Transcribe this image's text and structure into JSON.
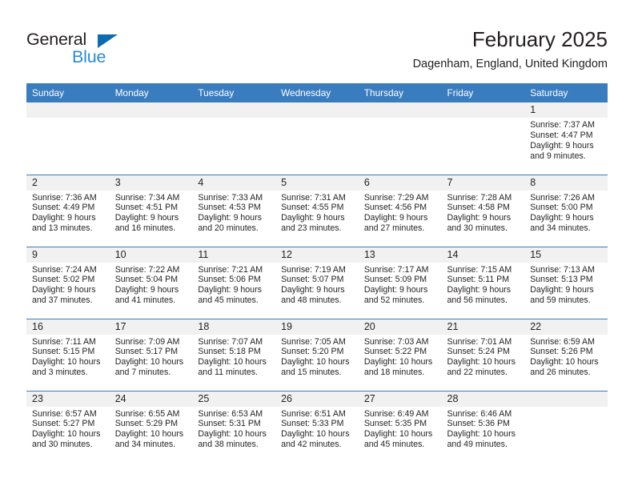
{
  "logo": {
    "word_one": "General",
    "word_two": "Blue",
    "triangle_icon": "blue-triangle-icon",
    "accent_dark": "#0f6ab0",
    "accent_light": "#2b8bd4"
  },
  "header": {
    "title": "February 2025",
    "subtitle": "Dagenham, England, United Kingdom"
  },
  "colors": {
    "header_blue": "#3a7dbf",
    "daynum_background": "#f1f1f1",
    "text": "#231f20"
  },
  "weekday_headers": [
    "Sunday",
    "Monday",
    "Tuesday",
    "Wednesday",
    "Thursday",
    "Friday",
    "Saturday"
  ],
  "labels": {
    "sunrise_prefix": "Sunrise:",
    "sunset_prefix": "Sunset:",
    "daylight_prefix": "Daylight:"
  },
  "weeks": [
    [
      {
        "day": "",
        "empty": true
      },
      {
        "day": "",
        "empty": true
      },
      {
        "day": "",
        "empty": true
      },
      {
        "day": "",
        "empty": true
      },
      {
        "day": "",
        "empty": true
      },
      {
        "day": "",
        "empty": true
      },
      {
        "day": "1",
        "sunrise": "Sunrise: 7:37 AM",
        "sunset": "Sunset: 4:47 PM",
        "daylight1": "Daylight: 9 hours",
        "daylight2": "and 9 minutes."
      }
    ],
    [
      {
        "day": "2",
        "sunrise": "Sunrise: 7:36 AM",
        "sunset": "Sunset: 4:49 PM",
        "daylight1": "Daylight: 9 hours",
        "daylight2": "and 13 minutes."
      },
      {
        "day": "3",
        "sunrise": "Sunrise: 7:34 AM",
        "sunset": "Sunset: 4:51 PM",
        "daylight1": "Daylight: 9 hours",
        "daylight2": "and 16 minutes."
      },
      {
        "day": "4",
        "sunrise": "Sunrise: 7:33 AM",
        "sunset": "Sunset: 4:53 PM",
        "daylight1": "Daylight: 9 hours",
        "daylight2": "and 20 minutes."
      },
      {
        "day": "5",
        "sunrise": "Sunrise: 7:31 AM",
        "sunset": "Sunset: 4:55 PM",
        "daylight1": "Daylight: 9 hours",
        "daylight2": "and 23 minutes."
      },
      {
        "day": "6",
        "sunrise": "Sunrise: 7:29 AM",
        "sunset": "Sunset: 4:56 PM",
        "daylight1": "Daylight: 9 hours",
        "daylight2": "and 27 minutes."
      },
      {
        "day": "7",
        "sunrise": "Sunrise: 7:28 AM",
        "sunset": "Sunset: 4:58 PM",
        "daylight1": "Daylight: 9 hours",
        "daylight2": "and 30 minutes."
      },
      {
        "day": "8",
        "sunrise": "Sunrise: 7:26 AM",
        "sunset": "Sunset: 5:00 PM",
        "daylight1": "Daylight: 9 hours",
        "daylight2": "and 34 minutes."
      }
    ],
    [
      {
        "day": "9",
        "sunrise": "Sunrise: 7:24 AM",
        "sunset": "Sunset: 5:02 PM",
        "daylight1": "Daylight: 9 hours",
        "daylight2": "and 37 minutes."
      },
      {
        "day": "10",
        "sunrise": "Sunrise: 7:22 AM",
        "sunset": "Sunset: 5:04 PM",
        "daylight1": "Daylight: 9 hours",
        "daylight2": "and 41 minutes."
      },
      {
        "day": "11",
        "sunrise": "Sunrise: 7:21 AM",
        "sunset": "Sunset: 5:06 PM",
        "daylight1": "Daylight: 9 hours",
        "daylight2": "and 45 minutes."
      },
      {
        "day": "12",
        "sunrise": "Sunrise: 7:19 AM",
        "sunset": "Sunset: 5:07 PM",
        "daylight1": "Daylight: 9 hours",
        "daylight2": "and 48 minutes."
      },
      {
        "day": "13",
        "sunrise": "Sunrise: 7:17 AM",
        "sunset": "Sunset: 5:09 PM",
        "daylight1": "Daylight: 9 hours",
        "daylight2": "and 52 minutes."
      },
      {
        "day": "14",
        "sunrise": "Sunrise: 7:15 AM",
        "sunset": "Sunset: 5:11 PM",
        "daylight1": "Daylight: 9 hours",
        "daylight2": "and 56 minutes."
      },
      {
        "day": "15",
        "sunrise": "Sunrise: 7:13 AM",
        "sunset": "Sunset: 5:13 PM",
        "daylight1": "Daylight: 9 hours",
        "daylight2": "and 59 minutes."
      }
    ],
    [
      {
        "day": "16",
        "sunrise": "Sunrise: 7:11 AM",
        "sunset": "Sunset: 5:15 PM",
        "daylight1": "Daylight: 10 hours",
        "daylight2": "and 3 minutes."
      },
      {
        "day": "17",
        "sunrise": "Sunrise: 7:09 AM",
        "sunset": "Sunset: 5:17 PM",
        "daylight1": "Daylight: 10 hours",
        "daylight2": "and 7 minutes."
      },
      {
        "day": "18",
        "sunrise": "Sunrise: 7:07 AM",
        "sunset": "Sunset: 5:18 PM",
        "daylight1": "Daylight: 10 hours",
        "daylight2": "and 11 minutes."
      },
      {
        "day": "19",
        "sunrise": "Sunrise: 7:05 AM",
        "sunset": "Sunset: 5:20 PM",
        "daylight1": "Daylight: 10 hours",
        "daylight2": "and 15 minutes."
      },
      {
        "day": "20",
        "sunrise": "Sunrise: 7:03 AM",
        "sunset": "Sunset: 5:22 PM",
        "daylight1": "Daylight: 10 hours",
        "daylight2": "and 18 minutes."
      },
      {
        "day": "21",
        "sunrise": "Sunrise: 7:01 AM",
        "sunset": "Sunset: 5:24 PM",
        "daylight1": "Daylight: 10 hours",
        "daylight2": "and 22 minutes."
      },
      {
        "day": "22",
        "sunrise": "Sunrise: 6:59 AM",
        "sunset": "Sunset: 5:26 PM",
        "daylight1": "Daylight: 10 hours",
        "daylight2": "and 26 minutes."
      }
    ],
    [
      {
        "day": "23",
        "sunrise": "Sunrise: 6:57 AM",
        "sunset": "Sunset: 5:27 PM",
        "daylight1": "Daylight: 10 hours",
        "daylight2": "and 30 minutes."
      },
      {
        "day": "24",
        "sunrise": "Sunrise: 6:55 AM",
        "sunset": "Sunset: 5:29 PM",
        "daylight1": "Daylight: 10 hours",
        "daylight2": "and 34 minutes."
      },
      {
        "day": "25",
        "sunrise": "Sunrise: 6:53 AM",
        "sunset": "Sunset: 5:31 PM",
        "daylight1": "Daylight: 10 hours",
        "daylight2": "and 38 minutes."
      },
      {
        "day": "26",
        "sunrise": "Sunrise: 6:51 AM",
        "sunset": "Sunset: 5:33 PM",
        "daylight1": "Daylight: 10 hours",
        "daylight2": "and 42 minutes."
      },
      {
        "day": "27",
        "sunrise": "Sunrise: 6:49 AM",
        "sunset": "Sunset: 5:35 PM",
        "daylight1": "Daylight: 10 hours",
        "daylight2": "and 45 minutes."
      },
      {
        "day": "28",
        "sunrise": "Sunrise: 6:46 AM",
        "sunset": "Sunset: 5:36 PM",
        "daylight1": "Daylight: 10 hours",
        "daylight2": "and 49 minutes."
      },
      {
        "day": "",
        "empty": true
      }
    ]
  ]
}
